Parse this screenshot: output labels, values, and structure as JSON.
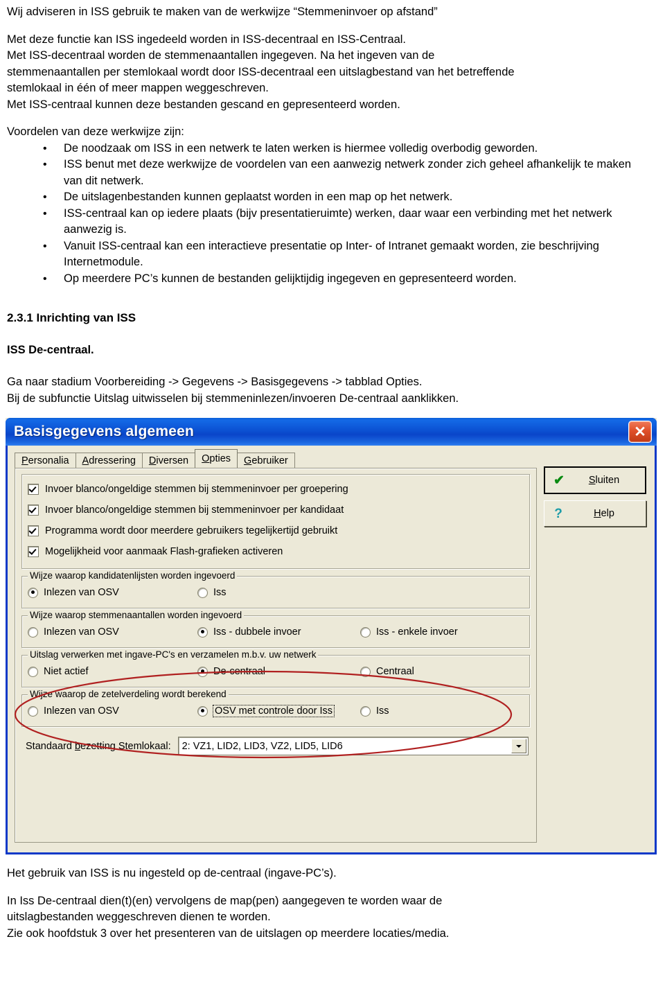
{
  "document": {
    "intro_heading": "Wij adviseren in ISS gebruik te maken van de werkwijze “Stemmeninvoer op afstand”",
    "paragraph1": [
      "Met deze functie kan ISS ingedeeld worden in ISS-decentraal en ISS-Centraal.",
      "Met ISS-decentraal worden de stemmenaantallen ingegeven. Na het ingeven van de",
      "stemmenaantallen per stemlokaal wordt door ISS-decentraal een uitslagbestand van het betreffende",
      "stemlokaal in één of meer mappen weggeschreven.",
      "Met ISS-centraal kunnen deze bestanden gescand en gepresenteerd worden."
    ],
    "advantages_intro": "Voordelen van deze werkwijze zijn:",
    "bullet_char": "•",
    "advantages": [
      "De noodzaak om ISS in een netwerk te laten werken is hiermee volledig overbodig geworden.",
      "ISS benut met deze werkwijze de voordelen van een aanwezig netwerk zonder zich geheel afhankelijk te maken van dit netwerk.",
      "De uitslagenbestanden kunnen geplaatst worden in een map op het netwerk.",
      "ISS-centraal kan op iedere plaats (bijv presentatieruimte) werken, daar waar een verbinding met het netwerk aanwezig is.",
      "Vanuit ISS-centraal kan een interactieve presentatie op Inter- of Intranet gemaakt worden, zie beschrijving Internetmodule.",
      "Op meerdere PC’s kunnen de bestanden gelijktijdig ingegeven en gepresenteerd worden."
    ],
    "section_heading": "2.3.1 Inrichting van ISS",
    "subheading": "ISS De-centraal.",
    "instructions": [
      "Ga naar stadium Voorbereiding -> Gegevens -> Basisgegevens -> tabblad Opties.",
      "Bij de subfunctie Uitslag uitwisselen bij stemmeninlezen/invoeren De-centraal aanklikken."
    ],
    "footer": [
      "Het gebruik van ISS is nu ingesteld op de-centraal (ingave-PC’s).",
      "In Iss De-centraal dien(t)(en) vervolgens de map(pen) aangegeven te worden waar de",
      "uitslagbestanden weggeschreven dienen te worden.",
      "Zie ook hoofdstuk 3 over het presenteren van de uitslagen op meerdere locaties/media."
    ]
  },
  "dialog": {
    "title": "Basisgegevens algemeen",
    "close_glyph": "✕",
    "tabs": [
      {
        "label": "Personalia",
        "accel": "P",
        "active": false
      },
      {
        "label": "Adressering",
        "accel": "A",
        "active": false
      },
      {
        "label": "Diversen",
        "accel": "D",
        "active": false
      },
      {
        "label": "Opties",
        "accel": "O",
        "active": true
      },
      {
        "label": "Gebruiker",
        "accel": "G",
        "active": false
      }
    ],
    "buttons": [
      {
        "label": "Sluiten",
        "accel": "S",
        "icon": "checkmark-icon",
        "glyph": "✔",
        "default": true
      },
      {
        "label": "Help",
        "accel": "H",
        "icon": "question-mark-icon",
        "glyph": "?",
        "default": false
      }
    ],
    "checkboxes": [
      {
        "label": "Invoer blanco/ongeldige stemmen bij stemmeninvoer per groepering",
        "checked": true
      },
      {
        "label": "Invoer blanco/ongeldige stemmen bij stemmeninvoer per kandidaat",
        "checked": true
      },
      {
        "label": "Programma wordt door meerdere gebruikers tegelijkertijd gebruikt",
        "checked": true
      },
      {
        "label": "Mogelijkheid voor aanmaak Flash-grafieken activeren",
        "checked": true
      }
    ],
    "groups": [
      {
        "legend": "Wijze waarop kandidatenlijsten worden ingevoerd",
        "highlighted": false,
        "options": [
          {
            "label": "Inlezen van OSV",
            "selected": true,
            "focused": false
          },
          {
            "label": "Iss",
            "selected": false,
            "focused": false
          }
        ]
      },
      {
        "legend": "Wijze waarop stemmenaantallen worden ingevoerd",
        "highlighted": false,
        "options": [
          {
            "label": "Inlezen van OSV",
            "selected": false,
            "focused": false
          },
          {
            "label": "Iss - dubbele invoer",
            "selected": true,
            "focused": false
          },
          {
            "label": "Iss - enkele invoer",
            "selected": false,
            "focused": false
          }
        ]
      },
      {
        "legend": "Uitslag verwerken met ingave-PC's en verzamelen m.b.v. uw netwerk",
        "highlighted": true,
        "options": [
          {
            "label": "Niet actief",
            "selected": false,
            "focused": false
          },
          {
            "label": "De-centraal",
            "selected": true,
            "focused": false
          },
          {
            "label": "Centraal",
            "selected": false,
            "focused": false
          }
        ]
      },
      {
        "legend": "Wijze waarop de zetelverdeling wordt berekend",
        "highlighted": false,
        "options": [
          {
            "label": "Inlezen van OSV",
            "selected": false,
            "focused": false
          },
          {
            "label": "OSV met controle door Iss",
            "selected": true,
            "focused": true
          },
          {
            "label": "Iss",
            "selected": false,
            "focused": false
          }
        ]
      }
    ],
    "combo": {
      "label": "Standaard bezetting Stemlokaal:",
      "accel": "b",
      "value": "2: VZ1, LID2, LID3, VZ2, LID5, LID6",
      "arrow": "▼"
    },
    "colors": {
      "titlebar_blue": "#0a45c9",
      "face": "#ece9d8",
      "annotation_red": "#b02020",
      "close_red": "#d2451c"
    }
  }
}
